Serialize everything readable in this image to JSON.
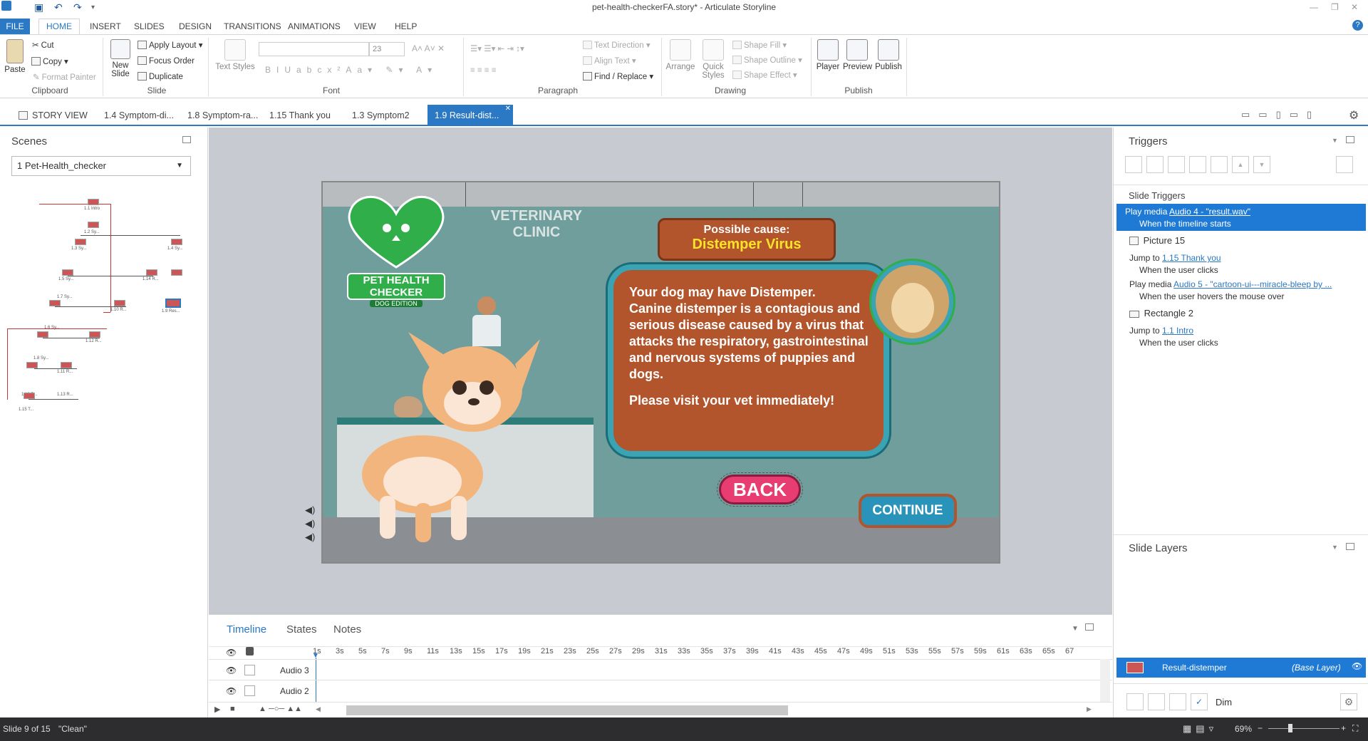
{
  "window": {
    "title": "pet-health-checkerFA.story* - Articulate Storyline"
  },
  "ribbon_tabs": [
    "FILE",
    "HOME",
    "INSERT",
    "SLIDES",
    "DESIGN",
    "TRANSITIONS",
    "ANIMATIONS",
    "VIEW",
    "HELP"
  ],
  "ribbon": {
    "clipboard": {
      "paste": "Paste",
      "cut": "Cut",
      "copy": "Copy",
      "format_painter": "Format Painter",
      "label": "Clipboard"
    },
    "slide": {
      "new_slide": "New Slide",
      "apply_layout": "Apply Layout",
      "focus_order": "Focus Order",
      "duplicate": "Duplicate",
      "label": "Slide"
    },
    "font": {
      "text_styles": "Text Styles",
      "size": "23",
      "label": "Font"
    },
    "paragraph": {
      "text_direction": "Text Direction",
      "align_text": "Align Text",
      "find_replace": "Find / Replace",
      "label": "Paragraph"
    },
    "drawing": {
      "arrange": "Arrange",
      "quick_styles": "Quick Styles",
      "shape_fill": "Shape Fill",
      "shape_outline": "Shape Outline",
      "shape_effect": "Shape Effect",
      "label": "Drawing"
    },
    "publish": {
      "player": "Player",
      "preview": "Preview",
      "publish": "Publish",
      "label": "Publish"
    }
  },
  "doc_tabs": {
    "story_view": "STORY VIEW",
    "tabs": [
      "1.4 Symptom-di...",
      "1.8 Symptom-ra...",
      "1.15 Thank you",
      "1.3 Symptom2"
    ],
    "active": "1.9 Result-dist..."
  },
  "scenes": {
    "title": "Scenes",
    "selected": "1 Pet-Health_checker",
    "nodes": [
      "1.1 Intro",
      "1.2 Sy...",
      "1.3 Sy...",
      "1.5 Sy...",
      "1.14 R...",
      "1.4 Sy...",
      "1.7 Sy...",
      "1.10 R...",
      "1.9 Res...",
      "1.6 Sy...",
      "1.12 R...",
      "1.8 Sy...",
      "1.11 R...",
      "1.13 R...",
      "1.15 T..."
    ]
  },
  "slide": {
    "clinic_sign_line1": "VETERINARY",
    "clinic_sign_line2": "CLINIC",
    "logo_text": "PET HEALTH CHECKER",
    "logo_sub": "DOG EDITION",
    "cause_label": "Possible cause:",
    "cause_value": "Distemper Virus",
    "body_line1": "Your dog may have Distemper.",
    "body_text": "Canine distemper is a contagious and serious disease caused by a virus that attacks the respiratory, gastrointestinal and nervous systems of puppies and dogs.",
    "body_cta": "Please visit your vet immediately!",
    "back_label": "BACK",
    "continue_label": "CONTINUE"
  },
  "timeline": {
    "tabs": [
      "Timeline",
      "States",
      "Notes"
    ],
    "ticks": [
      "1s",
      "3s",
      "5s",
      "7s",
      "9s",
      "11s",
      "13s",
      "15s",
      "17s",
      "19s",
      "21s",
      "23s",
      "25s",
      "27s",
      "29s",
      "31s",
      "33s",
      "35s",
      "37s",
      "39s",
      "41s",
      "43s",
      "45s",
      "47s",
      "49s",
      "51s",
      "53s",
      "55s",
      "57s",
      "59s",
      "61s",
      "63s",
      "65s",
      "67"
    ],
    "rows": [
      "Audio 3",
      "Audio 2"
    ]
  },
  "triggers": {
    "title": "Triggers",
    "section": "Slide Triggers",
    "items": [
      {
        "action": "Play media",
        "target": "Audio 4 - \"result.wav\"",
        "when": "When the timeline starts",
        "selected": true
      },
      {
        "object": "Picture 15"
      },
      {
        "action": "Jump to",
        "target": "1.15 Thank you",
        "when": "When the user clicks"
      },
      {
        "action": "Play media",
        "target": "Audio 5 - \"cartoon-ui---miracle-bleep by ...",
        "when": "When the user hovers the mouse over"
      },
      {
        "object": "Rectangle 2"
      },
      {
        "action": "Jump to",
        "target": "1.1 Intro",
        "when": "When the user clicks"
      }
    ]
  },
  "slide_layers": {
    "title": "Slide Layers",
    "base_name": "Result-distemper",
    "base_tag": "(Base Layer)",
    "dim_label": "Dim"
  },
  "status": {
    "slide_pos": "Slide 9 of 15",
    "theme": "\"Clean\"",
    "zoom": "69%"
  },
  "colors": {
    "accent": "#2b78c4",
    "status_bg": "#2d2d30"
  }
}
